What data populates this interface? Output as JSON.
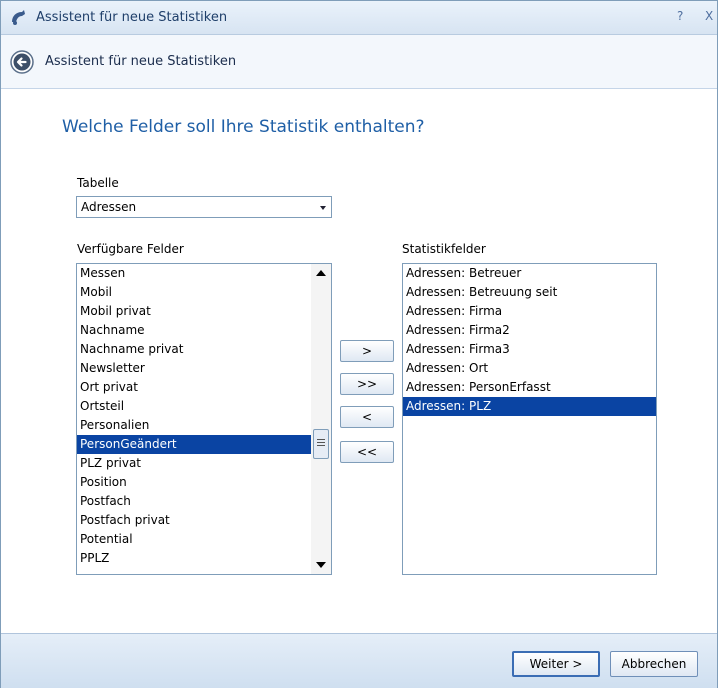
{
  "window": {
    "title": "Assistent für neue Statistiken",
    "help_glyph": "?",
    "close_glyph": "X"
  },
  "header": {
    "title": "Assistent für neue Statistiken"
  },
  "question": "Welche Felder soll Ihre Statistik enthalten?",
  "table": {
    "label": "Tabelle",
    "value": "Adressen"
  },
  "available": {
    "label": "Verfügbare Felder",
    "items": [
      "Messen",
      "Mobil",
      "Mobil privat",
      "Nachname",
      "Nachname privat",
      "Newsletter",
      "Ort privat",
      "Ortsteil",
      "Personalien",
      "PersonGeändert",
      "PLZ privat",
      "Position",
      "Postfach",
      "Postfach privat",
      "Potential",
      "PPLZ"
    ],
    "selected_index": 9
  },
  "statistik": {
    "label": "Statistikfelder",
    "items": [
      "Adressen: Betreuer",
      "Adressen: Betreuung seit",
      "Adressen: Firma",
      "Adressen: Firma2",
      "Adressen: Firma3",
      "Adressen: Ort",
      "Adressen: PersonErfasst",
      "Adressen: PLZ"
    ],
    "selected_index": 7
  },
  "move_buttons": {
    "add": ">",
    "add_all": ">>",
    "remove": "<",
    "remove_all": "<<"
  },
  "footer": {
    "next": "Weiter >",
    "cancel": "Abbrechen"
  },
  "colors": {
    "accent": "#1f5fa6",
    "selection": "#0a44a3"
  }
}
